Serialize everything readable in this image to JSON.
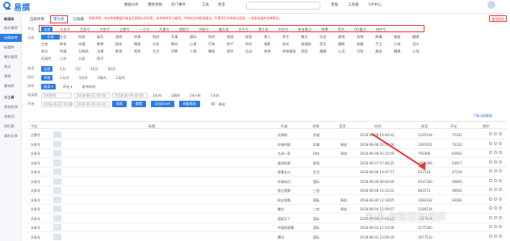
{
  "app": {
    "logo": "易撰"
  },
  "top_nav": [
    "数据分析",
    "爆款视频",
    "热门事件",
    "工具",
    "更多"
  ],
  "top_right": [
    "客服",
    "工具箱",
    "VIP中心"
  ],
  "sidebar": {
    "items": [
      {
        "label": "新媒体",
        "type": "head"
      },
      {
        "label": "热文推荐",
        "type": "normal"
      },
      {
        "label": "自媒体库",
        "type": "active"
      },
      {
        "label": "标题库",
        "type": "normal"
      },
      {
        "label": "爆文推荐",
        "type": "normal"
      },
      {
        "label": "热点",
        "type": "normal"
      },
      {
        "label": "视频",
        "type": "normal"
      },
      {
        "label": "素材库",
        "type": "normal"
      },
      {
        "label": "小工具",
        "type": "head"
      },
      {
        "label": "原创检测",
        "type": "normal"
      },
      {
        "label": "违禁词",
        "type": "normal"
      },
      {
        "label": "排行榜",
        "type": "normal"
      },
      {
        "label": "我的文章",
        "type": "normal"
      }
    ]
  },
  "filter": {
    "tabs": [
      "自媒体库",
      "爆文库",
      "已收藏"
    ],
    "notice": "免责声明：本站所有数据均来自互联网公开信息，仅供参考学习使用，不构成任何投资建议，不得用于任何商业用途，一经发现追究法律责任。",
    "filter_button": "使用帮助",
    "platform_label": "平台",
    "platforms": [
      "全部",
      "头条号",
      "百家号",
      "大鱼号",
      "企鹅号",
      "一点号",
      "凤凰号",
      "搜狐号",
      "网易号",
      "趣头条",
      "东方号",
      "惠头条",
      "时间号",
      "新浪看点",
      "微博",
      "简书",
      "QQ看点",
      "快传号"
    ],
    "category_label": "分类",
    "categories": [
      [
        "全部",
        "社会",
        "科技",
        "娱乐",
        "游戏",
        "体育",
        "财经",
        "军事",
        "国际",
        "时尚",
        "旅游",
        "探索",
        "育儿",
        "养生",
        "美文",
        "历史",
        "美食",
        "宠物",
        "故事",
        "星座",
        "健康",
        "家居"
      ],
      [
        "三农",
        "职场",
        "动漫",
        "教育",
        "搞笑",
        "情感",
        "文化",
        "数码",
        "心理",
        "汽车",
        "房产",
        "科学",
        "电影",
        "综艺",
        "电视剧",
        "音乐",
        "摄影",
        "收藏",
        "手工",
        "小说",
        "设计",
        "口腔"
      ],
      [
        "热点",
        "传媒",
        "互联网",
        "法律",
        "影视",
        "两性",
        "生活",
        "宗教",
        "人物",
        "舞蹈",
        "国学",
        "运动",
        "其他",
        "体育健身",
        "家庭",
        "婚姻",
        "心灵",
        "百科",
        "美妆",
        "摄像",
        "小孩",
        "名人"
      ],
      [
        "纪录片",
        "八卦",
        "公益",
        "段子"
      ]
    ],
    "read_label": "阅读",
    "read_options": [
      "全部",
      "1万",
      "5万",
      "10万",
      "50万"
    ],
    "time_label": "时间",
    "time_options": [
      "不限",
      "1天内",
      "3天内",
      "1周内",
      "1月内"
    ],
    "sort_label": "排序",
    "sort_options": [
      "阅读 ▾",
      "评论 ▾",
      "发布时间"
    ],
    "min_read_label": "阅读数",
    "min_read_value": "500000",
    "start_date": "2018-06-01 00:00",
    "end_date": "2018-06-09 00:00",
    "time_chips": [
      "3天内",
      "1周内",
      "24小时",
      "7天内"
    ],
    "date_start_label": "开始",
    "search_button": "搜索",
    "reset_button": "重置",
    "export_button": "导出Excel",
    "advanced_button": "高级筛选",
    "original_label": "原创"
  },
  "table": {
    "export_label": "下载当前数据",
    "headers": [
      "平台",
      "标题",
      "作者",
      "领域",
      "类型",
      "时间",
      "阅读",
      "评论",
      "操作"
    ],
    "rows": [
      {
        "platform": "企鹅号",
        "title": "",
        "author": "光明网",
        "field": "传媒",
        "type": "",
        "time": "2018-06-06 19:40:42",
        "read": "1335544",
        "comment": "75203",
        "tag": ""
      },
      {
        "platform": "头条号",
        "title": "",
        "author": "环球时报",
        "field": "军事",
        "type": "原创",
        "time": "2018-06-06 14:57:06",
        "read": "1397951",
        "comment": "70122",
        "tag": ""
      },
      {
        "platform": "头条号",
        "title": "",
        "author": "台湾一家",
        "field": "科技",
        "type": "原创",
        "time": "2018-06-08 01:15:00",
        "read": "793396",
        "comment": "65603",
        "tag": ""
      },
      {
        "platform": "头条号",
        "title": "",
        "author": "泰润的家",
        "field": "职场",
        "type": "",
        "time": "2018-06-07 07:49:25",
        "read": "2996266",
        "comment": "54917",
        "tag": ""
      },
      {
        "platform": "头条号",
        "title": "",
        "author": "智慧长沙",
        "field": "生活",
        "type": "",
        "time": "2018-06-06 14:47:57",
        "read": "627518",
        "comment": "47516",
        "tag": ""
      },
      {
        "platform": "头条号",
        "title": "",
        "author": "环球热点",
        "field": "国际",
        "type": "",
        "time": "2018-06-06 00:00:00",
        "read": "4437300",
        "comment": "39893",
        "tag": ""
      },
      {
        "platform": "头条号",
        "title": "",
        "author": "独立视野",
        "field": "三农",
        "type": "",
        "time": "2018-06-06 10:10:22",
        "read": "865572",
        "comment": "39602",
        "tag": ""
      },
      {
        "platform": "头条号",
        "title": "",
        "author": "网五视频",
        "field": "国际",
        "type": "原创",
        "time": "2018-06-06 12:18:05",
        "read": "1682342",
        "comment": "36082",
        "tag": ""
      },
      {
        "platform": "头条号",
        "title": "",
        "author": "爆点",
        "field": "三农",
        "type": "原创",
        "time": "2018-06-04 15:09:07",
        "read": "2180534",
        "comment": "",
        "tag": ""
      },
      {
        "platform": "头条号",
        "title": "",
        "author": "图说天下",
        "field": "国际",
        "type": "",
        "time": "2018-06-04 11:03:41",
        "read": "1167548",
        "comment": "",
        "tag": ""
      },
      {
        "platform": "头条号",
        "title": "",
        "author": "中国网直播",
        "field": "国际",
        "type": "",
        "time": "2018-06-02 11:24:08",
        "read": "2175300",
        "comment": "",
        "tag": ""
      },
      {
        "platform": "头条号",
        "title": "",
        "author": "腾讯",
        "field": "国际",
        "type": "",
        "time": "2018-06-01 10:09:26",
        "read": "1677533",
        "comment": "",
        "tag": ""
      }
    ]
  },
  "watermark": "知乎 @陈默自媒体"
}
